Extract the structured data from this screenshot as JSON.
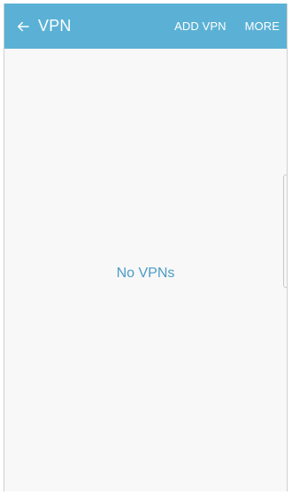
{
  "app_bar": {
    "title": "VPN",
    "back_icon": "arrow-left-icon",
    "actions": {
      "add_vpn": "ADD VPN",
      "more": "MORE"
    },
    "color": "#5bb1d5"
  },
  "main": {
    "empty_message": "No VPNs",
    "empty_message_color": "#4c9cc6"
  }
}
